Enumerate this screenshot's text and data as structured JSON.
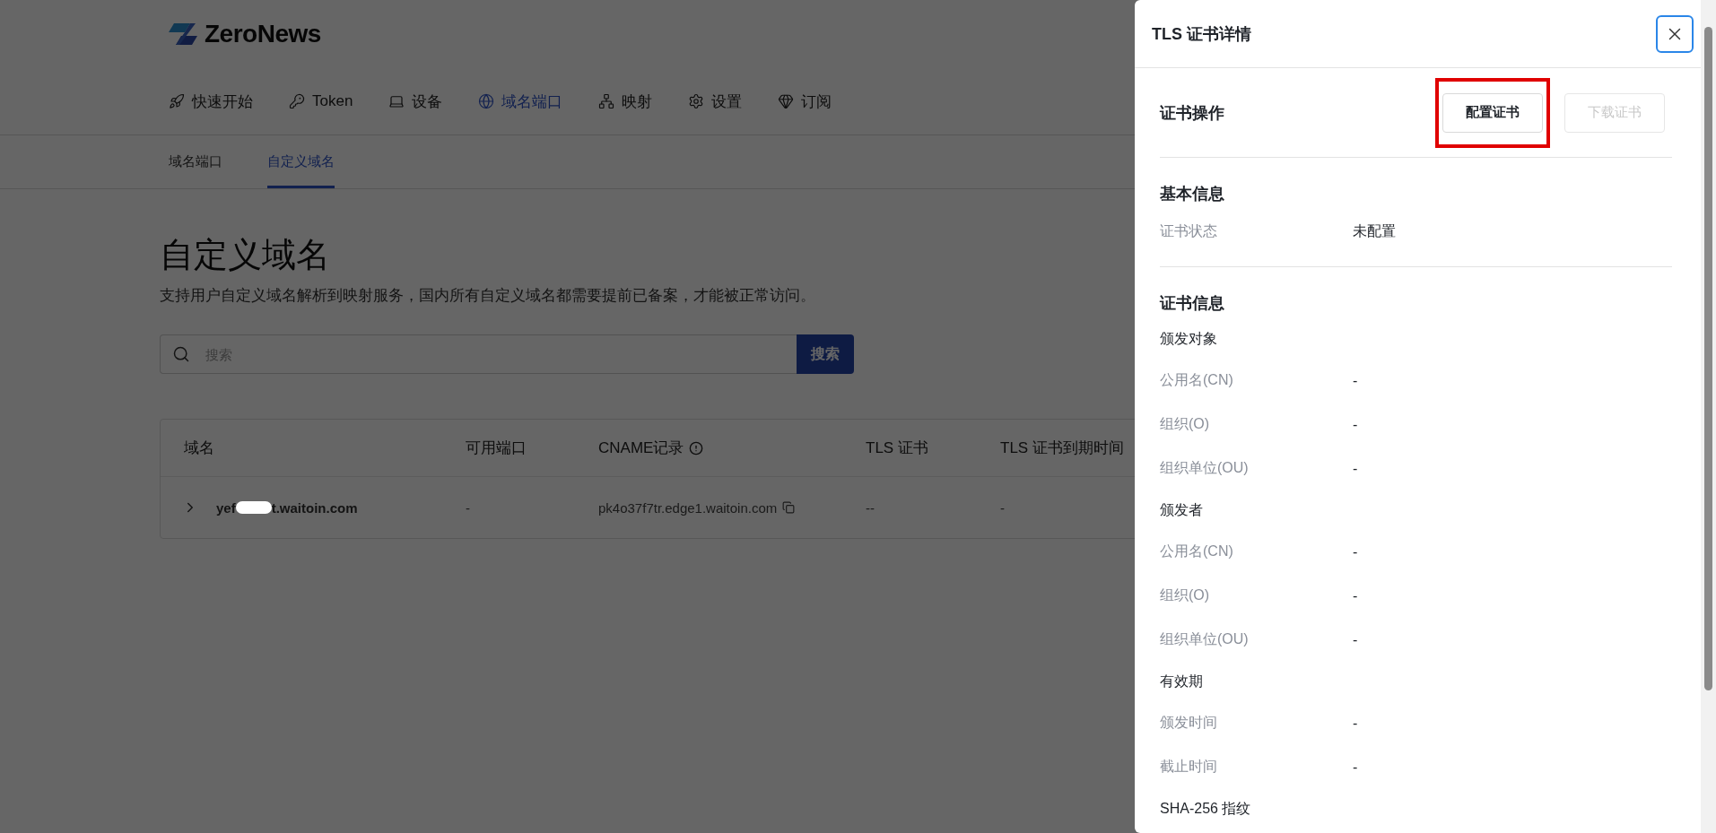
{
  "logo": {
    "text": "ZeroNews"
  },
  "nav": [
    {
      "label": "快速开始",
      "selected": false
    },
    {
      "label": "Token",
      "selected": false
    },
    {
      "label": "设备",
      "selected": false
    },
    {
      "label": "域名端口",
      "selected": true
    },
    {
      "label": "映射",
      "selected": false
    },
    {
      "label": "设置",
      "selected": false
    },
    {
      "label": "订阅",
      "selected": false
    }
  ],
  "sub_tabs": [
    {
      "label": "域名端口",
      "selected": false
    },
    {
      "label": "自定义域名",
      "selected": true
    }
  ],
  "page": {
    "title": "自定义域名",
    "description": "支持用户自定义域名解析到映射服务，国内所有自定义域名都需要提前已备案，才能被正常访问。"
  },
  "search": {
    "placeholder": "搜索",
    "button": "搜索"
  },
  "table": {
    "columns": [
      {
        "label": "域名"
      },
      {
        "label": "可用端口"
      },
      {
        "label": "CNAME记录",
        "info": true
      },
      {
        "label": "TLS 证书"
      },
      {
        "label": "TLS 证书到期时间"
      }
    ],
    "rows": [
      {
        "expanded": false,
        "domain_prefix": "yef",
        "redacted": true,
        "domain_suffix": "t.waitoin.com",
        "ports": "-",
        "cname": "pk4o37f7tr.edge1.waitoin.com",
        "tls": "--",
        "tls_expiry": "-"
      }
    ]
  },
  "drawer": {
    "title": "TLS 证书详情",
    "actions": {
      "label": "证书操作",
      "buttons": [
        {
          "label": "配置证书",
          "disabled": false,
          "highlighted": true
        },
        {
          "label": "下载证书",
          "disabled": true,
          "highlighted": false
        }
      ]
    },
    "sections": [
      {
        "title": "基本信息",
        "items": [
          {
            "kind": "field",
            "label": "证书状态",
            "value": "未配置"
          }
        ]
      },
      {
        "title": "证书信息",
        "items": [
          {
            "kind": "subhead",
            "label": "颁发对象"
          },
          {
            "kind": "field",
            "label": "公用名(CN)",
            "value": "-"
          },
          {
            "kind": "field",
            "label": "组织(O)",
            "value": "-"
          },
          {
            "kind": "field",
            "label": "组织单位(OU)",
            "value": "-"
          },
          {
            "kind": "subhead",
            "label": "颁发者"
          },
          {
            "kind": "field",
            "label": "公用名(CN)",
            "value": "-"
          },
          {
            "kind": "field",
            "label": "组织(O)",
            "value": "-"
          },
          {
            "kind": "field",
            "label": "组织单位(OU)",
            "value": "-"
          },
          {
            "kind": "subhead",
            "label": "有效期"
          },
          {
            "kind": "field",
            "label": "颁发时间",
            "value": "-"
          },
          {
            "kind": "field",
            "label": "截止时间",
            "value": "-"
          },
          {
            "kind": "subhead",
            "label": "SHA-256 指纹"
          }
        ]
      }
    ]
  }
}
